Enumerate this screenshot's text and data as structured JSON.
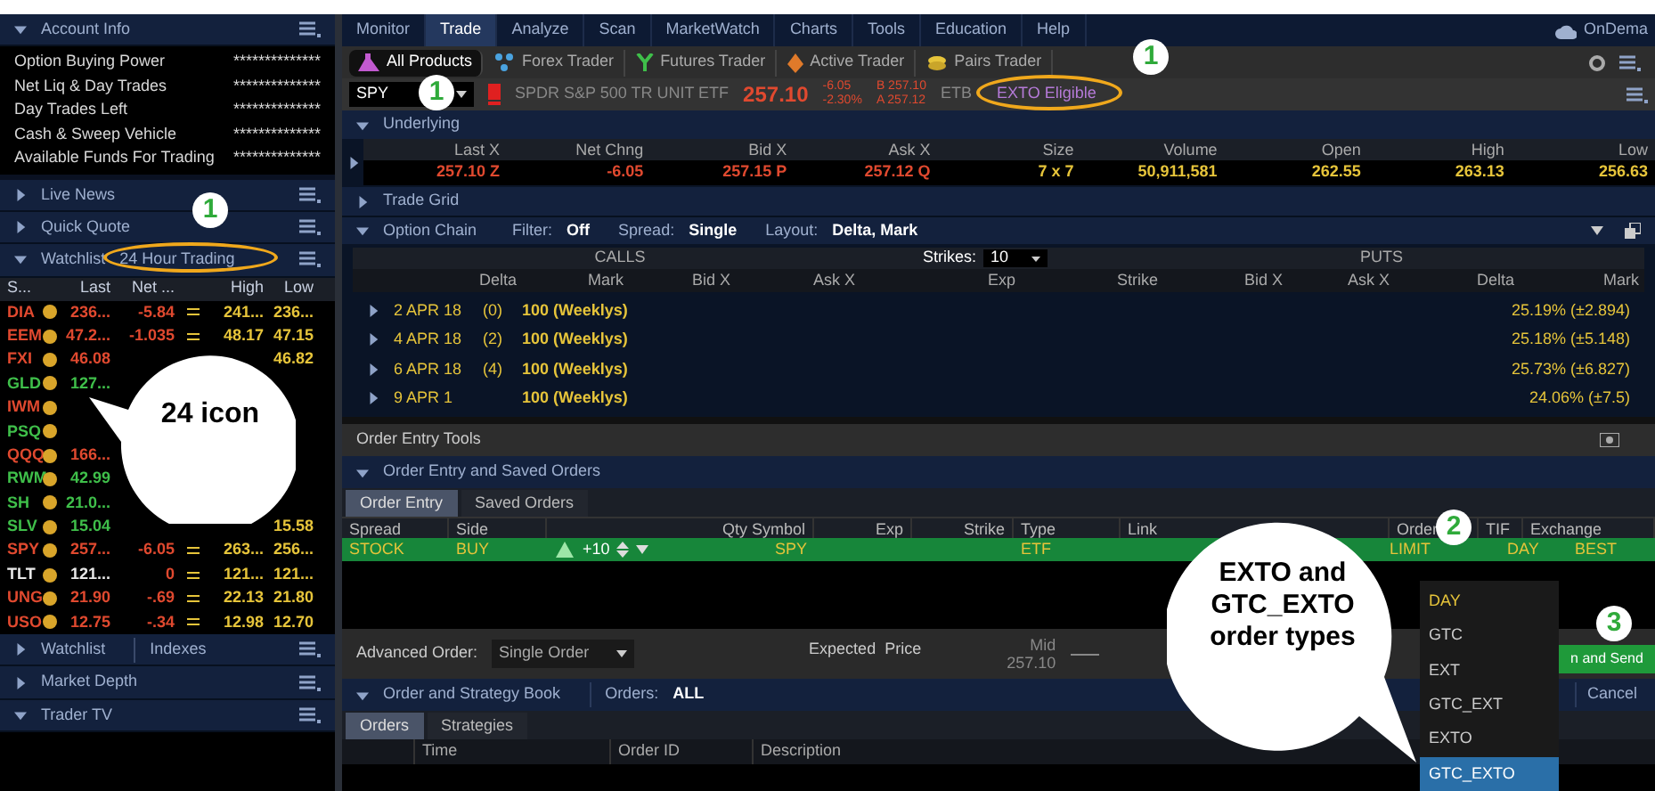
{
  "sidebar": {
    "account_info": {
      "title": "Account Info",
      "expanded": true,
      "rows": [
        {
          "label": "Option Buying Power",
          "value": "**************"
        },
        {
          "label": "Net Liq & Day Trades",
          "value": "**************"
        },
        {
          "label": "Day Trades Left",
          "value": "**************"
        },
        {
          "label": "Cash & Sweep Vehicle",
          "value": "**************"
        },
        {
          "label": "Available Funds For Trading",
          "value": "**************"
        }
      ]
    },
    "panels_top": [
      {
        "title": "Live News",
        "expanded": false
      },
      {
        "title": "Quick Quote",
        "expanded": false
      }
    ],
    "watchlist": {
      "title": "Watchlist",
      "list": "24 Hour Trading",
      "expanded": true,
      "columns": [
        "S...",
        "Last",
        "Net ...",
        "High",
        "Low"
      ],
      "rows": [
        {
          "symbol": "DIA",
          "color": "#e0492f",
          "last": "236...",
          "net": "-5.84",
          "high": "241...",
          "low": "236..."
        },
        {
          "symbol": "EEM",
          "color": "#e0492f",
          "last": "47.2...",
          "net": "-1.035",
          "high": "48.17",
          "low": "47.15"
        },
        {
          "symbol": "FXI",
          "color": "#e0492f",
          "last": "46.08",
          "low": "46.82"
        },
        {
          "symbol": "GLD",
          "color": "#3fbf4a",
          "last": "127..."
        },
        {
          "symbol": "IWM",
          "color": "#e0492f"
        },
        {
          "symbol": "PSQ",
          "color": "#3fbf4a"
        },
        {
          "symbol": "QQQ",
          "color": "#e0492f",
          "last": "166..."
        },
        {
          "symbol": "RWM",
          "color": "#3fbf4a",
          "last": "42.99"
        },
        {
          "symbol": "SH",
          "color": "#3fbf4a",
          "last": "21.0..."
        },
        {
          "symbol": "SLV",
          "color": "#3fbf4a",
          "last": "15.04",
          "low": "15.58"
        },
        {
          "symbol": "SPY",
          "color": "#e0492f",
          "last": "257...",
          "net": "-6.05",
          "high": "263...",
          "low": "256..."
        },
        {
          "symbol": "TLT",
          "color": "#e8e8e8",
          "last": "121...",
          "net": "0",
          "high": "121...",
          "low": "121..."
        },
        {
          "symbol": "UNG",
          "color": "#e0492f",
          "last": "21.90",
          "net": "-.69",
          "high": "22.13",
          "low": "21.80"
        },
        {
          "symbol": "USO",
          "color": "#e0492f",
          "last": "12.75",
          "net": "-.34",
          "high": "12.98",
          "low": "12.70"
        }
      ]
    },
    "panels_bottom": [
      {
        "title": "Watchlist",
        "subtitle": "Indexes",
        "expanded": false
      },
      {
        "title": "Market Depth",
        "expanded": false
      },
      {
        "title": "Trader TV",
        "expanded": true
      }
    ]
  },
  "menu": {
    "tabs": [
      {
        "label": "Monitor",
        "selected": false
      },
      {
        "label": "Trade",
        "selected": true
      },
      {
        "label": "Analyze",
        "selected": false
      },
      {
        "label": "Scan",
        "selected": false
      },
      {
        "label": "MarketWatch",
        "selected": false
      },
      {
        "label": "Charts",
        "selected": false
      },
      {
        "label": "Tools",
        "selected": false
      },
      {
        "label": "Education",
        "selected": false
      },
      {
        "label": "Help",
        "selected": false
      }
    ],
    "ondemand": "OnDema"
  },
  "toolbar": [
    {
      "label": "All Products",
      "selected": true,
      "kind": "products"
    },
    {
      "label": "Forex Trader",
      "selected": false,
      "kind": "forex"
    },
    {
      "label": "Futures Trader",
      "selected": false,
      "kind": "futures"
    },
    {
      "label": "Active Trader",
      "selected": false,
      "kind": "active"
    },
    {
      "label": "Pairs Trader",
      "selected": false,
      "kind": "pairs"
    }
  ],
  "symbol_bar": {
    "symbol": "SPY",
    "description": "SPDR S&P 500 TR UNIT ETF",
    "price": "257.10",
    "change": "-6.05",
    "change_pct": "-2.30%",
    "bid": "B 257.10",
    "ask": "A 257.12",
    "etb": "ETB",
    "exto": "EXTO Eligible"
  },
  "underlying": {
    "title": "Underlying",
    "expanded": true,
    "columns": [
      "Last X",
      "Net Chng",
      "Bid X",
      "Ask X",
      "Size",
      "Volume",
      "Open",
      "High",
      "Low"
    ],
    "values": [
      {
        "text": "257.10 Z",
        "color": "#e0492f"
      },
      {
        "text": "-6.05",
        "color": "#e0492f"
      },
      {
        "text": "257.15 P",
        "color": "#e0492f"
      },
      {
        "text": "257.12 Q",
        "color": "#e0492f"
      },
      {
        "text": "7 x 7",
        "color": "#e6c43a"
      },
      {
        "text": "50,911,581",
        "color": "#e6c43a"
      },
      {
        "text": "262.55",
        "color": "#e6c43a"
      },
      {
        "text": "263.13",
        "color": "#e6c43a"
      },
      {
        "text": "256.63",
        "color": "#e6c43a"
      }
    ]
  },
  "trade_grid": {
    "title": "Trade Grid",
    "expanded": false
  },
  "option_chain": {
    "title": "Option Chain",
    "expanded": true,
    "filter_label": "Filter:",
    "filter": "Off",
    "spread_label": "Spread:",
    "spread": "Single",
    "layout_label": "Layout:",
    "layout": "Delta, Mark",
    "calls": "CALLS",
    "strikes_label": "Strikes:",
    "strikes": "10",
    "puts": "PUTS",
    "columns": [
      "Delta",
      "Mark",
      "Bid X",
      "Ask X",
      "Exp",
      "Strike",
      "Bid X",
      "Ask X",
      "Delta",
      "Mark"
    ],
    "rows": [
      {
        "date": "2 APR 18",
        "days": "(0)",
        "series": "100 (Weeklys)",
        "iv": "25.19% (±2.894)"
      },
      {
        "date": "4 APR 18",
        "days": "(2)",
        "series": "100 (Weeklys)",
        "iv": "25.18% (±5.148)"
      },
      {
        "date": "6 APR 18",
        "days": "(4)",
        "series": "100 (Weeklys)",
        "iv": "25.73% (±6.827)"
      },
      {
        "date": "9 APR 1",
        "series": "100 (Weeklys)",
        "iv": "24.06% (±7.5)"
      }
    ]
  },
  "order_entry_tools": "Order Entry Tools",
  "order_entry": {
    "title": "Order Entry and Saved Orders",
    "tabs": [
      {
        "label": "Order Entry",
        "selected": true
      },
      {
        "label": "Saved Orders",
        "selected": false
      }
    ],
    "columns": [
      "Spread",
      "Side",
      "Qty Symbol",
      "Exp",
      "Strike",
      "Type",
      "Link",
      "Order",
      "TIF",
      "Exchange"
    ],
    "row": {
      "spread": "STOCK",
      "side": "BUY",
      "qty": "+10",
      "symbol": "SPY",
      "type": "ETF",
      "order": "LIMIT",
      "tif": "DAY",
      "exchange": "BEST"
    }
  },
  "tif_menu": [
    {
      "label": "DAY",
      "selected": false,
      "current": true
    },
    {
      "label": "GTC",
      "selected": false,
      "current": false
    },
    {
      "label": "EXT",
      "selected": false,
      "current": false
    },
    {
      "label": "GTC_EXT",
      "selected": false,
      "current": false
    },
    {
      "label": "EXTO",
      "selected": false,
      "current": false
    },
    {
      "label": "GTC_EXTO",
      "selected": true,
      "current": false
    }
  ],
  "advanced": {
    "label": "Advanced Order:",
    "value": "Single Order",
    "expected": "Expected  Price",
    "mid_label": "Mid",
    "mid": "257.10",
    "send": "n and Send"
  },
  "order_book": {
    "title": "Order and Strategy Book",
    "orders_label": "Orders:",
    "orders": "ALL",
    "cancel": "Cancel",
    "tabs": [
      {
        "label": "Orders",
        "selected": true
      },
      {
        "label": "Strategies",
        "selected": false
      }
    ],
    "columns": [
      "Time",
      "Order ID",
      "Description"
    ]
  },
  "annotations": {
    "badges": [
      "1",
      "1",
      "1",
      "2",
      "3"
    ],
    "callouts": [
      "24 icon",
      "EXTO and GTC_EXTO order types"
    ]
  }
}
